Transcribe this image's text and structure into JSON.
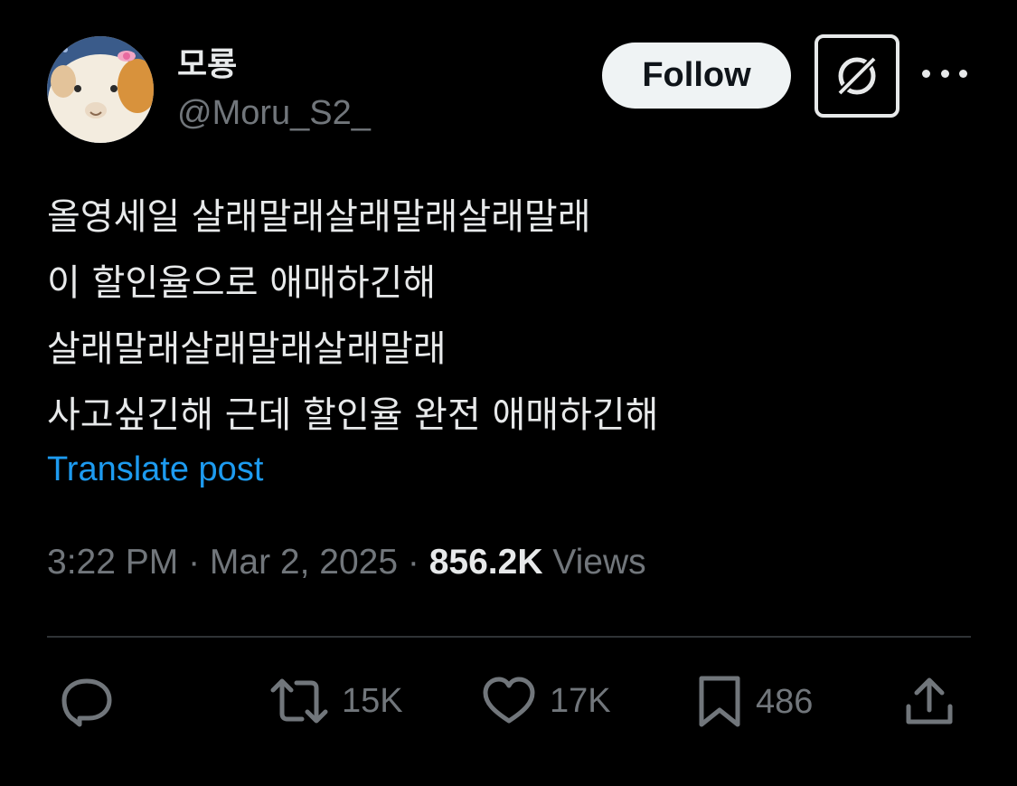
{
  "author": {
    "display_name": "모룡",
    "handle": "@Moru_S2_",
    "avatar_icon": "guinea-pig-avatar"
  },
  "header": {
    "follow_label": "Follow",
    "grok_icon": "grok-icon",
    "more_icon": "more-icon"
  },
  "post": {
    "lines": [
      "올영세일 살래말래살래말래살래말래",
      "이 할인율으로 애매하긴해",
      "살래말래살래말래살래말래",
      "사고싶긴해 근데 할인율 완전 애매하긴해"
    ],
    "translate_label": "Translate post"
  },
  "meta": {
    "time": "3:22 PM",
    "separator1": " · ",
    "date": "Mar 2, 2025",
    "separator2": " · ",
    "views_count": "856.2K",
    "views_label": " Views"
  },
  "actions": {
    "reply": {
      "icon": "reply-icon"
    },
    "repost": {
      "icon": "repost-icon",
      "count": "15K"
    },
    "like": {
      "icon": "heart-icon",
      "count": "17K"
    },
    "bookmark": {
      "icon": "bookmark-icon",
      "count": "486"
    },
    "share": {
      "icon": "share-icon"
    }
  },
  "colors": {
    "background": "#000000",
    "text_primary": "#e7e9ea",
    "text_secondary": "#71767b",
    "link": "#1d9bf0",
    "divider": "#2f3336",
    "follow_bg": "#eff3f4"
  }
}
